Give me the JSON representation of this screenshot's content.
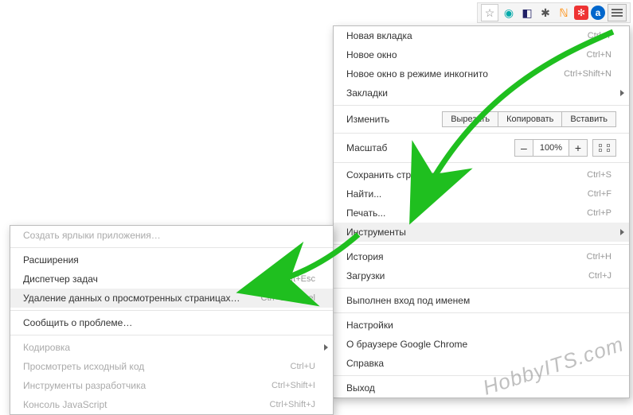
{
  "toolbar": {
    "star": "☆",
    "ext_eye": "◉",
    "ext_shield": "◧",
    "ext_bug": "✱",
    "ext_rss": "ℕ",
    "ext_red": "✻",
    "ext_a": "a"
  },
  "menu": {
    "new_tab": "Новая вкладка",
    "new_tab_sc": "Ctrl+T",
    "new_window": "Новое окно",
    "new_window_sc": "Ctrl+N",
    "incognito": "Новое окно в режиме инкогнито",
    "incognito_sc": "Ctrl+Shift+N",
    "bookmarks": "Закладки",
    "edit": "Изменить",
    "cut": "Вырезать",
    "copy": "Копировать",
    "paste": "Вставить",
    "zoom": "Масштаб",
    "zoom_minus": "–",
    "zoom_val": "100%",
    "zoom_plus": "+",
    "save_page": "Сохранить страницу как...",
    "save_page_sc": "Ctrl+S",
    "find": "Найти...",
    "find_sc": "Ctrl+F",
    "print": "Печать...",
    "print_sc": "Ctrl+P",
    "tools": "Инструменты",
    "history": "История",
    "history_sc": "Ctrl+H",
    "downloads": "Загрузки",
    "downloads_sc": "Ctrl+J",
    "signed_in": "Выполнен вход под именем",
    "settings": "Настройки",
    "about": "О браузере Google Chrome",
    "help": "Справка",
    "exit": "Выход"
  },
  "submenu": {
    "create_shortcuts": "Создать ярлыки приложения…",
    "extensions": "Расширения",
    "task_manager": "Диспетчер задач",
    "task_manager_sc": "Shift+Esc",
    "clear_data": "Удаление данных о просмотренных страницах…",
    "clear_data_sc": "Ctrl+Shift+Del",
    "report_issue": "Сообщить о проблеме…",
    "encoding": "Кодировка",
    "view_source": "Просмотреть исходный код",
    "view_source_sc": "Ctrl+U",
    "dev_tools": "Инструменты разработчика",
    "dev_tools_sc": "Ctrl+Shift+I",
    "js_console": "Консоль JavaScript",
    "js_console_sc": "Ctrl+Shift+J"
  },
  "watermark": "HobbyITS.com"
}
